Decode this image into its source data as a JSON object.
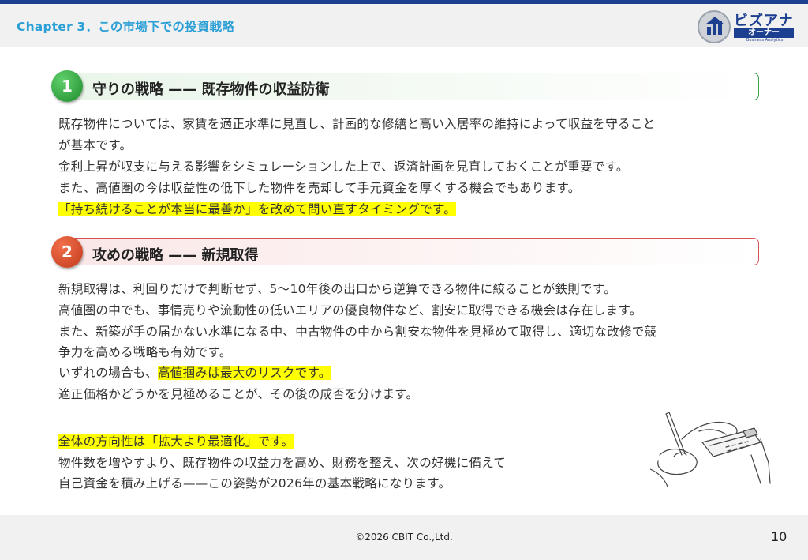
{
  "header": {
    "chapter_title": "Chapter 3．この市場下での投資戦略",
    "logo": {
      "line1": "ビズアナ",
      "line2": "オーナー",
      "line3": "Business Analytics"
    }
  },
  "section1": {
    "number": "1",
    "title": "守りの戦略 —— 既存物件の収益防衛",
    "lines": [
      "既存物件については、家賃を適正水準に見直し、計画的な修繕と高い入居率の維持によって収益を守ること",
      "が基本です。",
      "金利上昇が収支に与える影響をシミュレーションした上で、返済計画を見直しておくことが重要です。",
      "また、高値圏の今は収益性の低下した物件を売却して手元資金を厚くする機会でもあります。"
    ],
    "highlight": "「持ち続けることが本当に最善か」を改めて問い直すタイミングです。"
  },
  "section2": {
    "number": "2",
    "title": "攻めの戦略 —— 新規取得",
    "lines": [
      "新規取得は、利回りだけで判断せず、5〜10年後の出口から逆算できる物件に絞ることが鉄則です。",
      "高値圏の中でも、事情売りや流動性の低いエリアの優良物件など、割安に取得できる機会は存在します。",
      "また、新築が手の届かない水準になる中、中古物件の中から割安な物件を見極めて取得し、適切な改修で競",
      "争力を高める戦略も有効です。"
    ],
    "risk_prefix": "いずれの場合も、",
    "risk_highlight": "高値掴みは最大のリスクです。",
    "last_line": "適正価格かどうかを見極めることが、その後の成否を分けます。"
  },
  "summary": {
    "highlight": "全体の方向性は「拡大より最適化」です。",
    "lines": [
      "物件数を増やすより、既存物件の収益力を高め、財務を整え、次の好機に備えて",
      "自己資金を積み上げる——この姿勢が2026年の基本戦略になります。"
    ],
    "illustration": "hand-calculator-illustration"
  },
  "footer": {
    "copyright": "©2026 CBIT Co.,Ltd.",
    "page_number": "10"
  }
}
